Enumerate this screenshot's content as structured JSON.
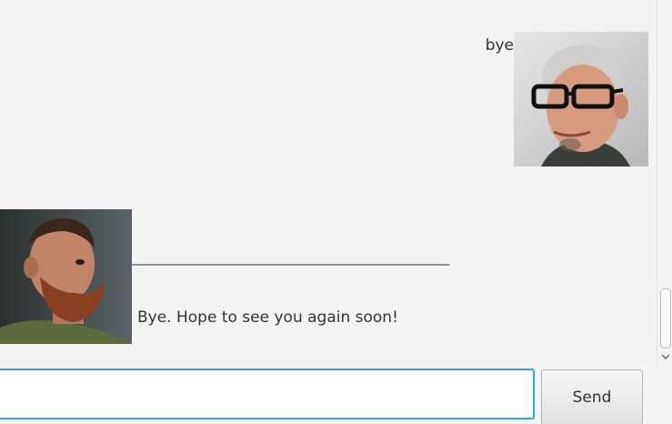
{
  "chat": {
    "messages": [
      {
        "sender": "user",
        "text": "bye",
        "avatar_icon": "user-avatar"
      },
      {
        "sender": "bot",
        "divider": "____________________________________________________________",
        "text": "Bye. Hope to see you again soon!",
        "avatar_icon": "bot-avatar"
      }
    ]
  },
  "input": {
    "value": "",
    "placeholder": ""
  },
  "send_button": {
    "label": "Send"
  },
  "colors": {
    "chat_background": "#f3f3f3",
    "input_focus_border": "#31a7dd"
  }
}
